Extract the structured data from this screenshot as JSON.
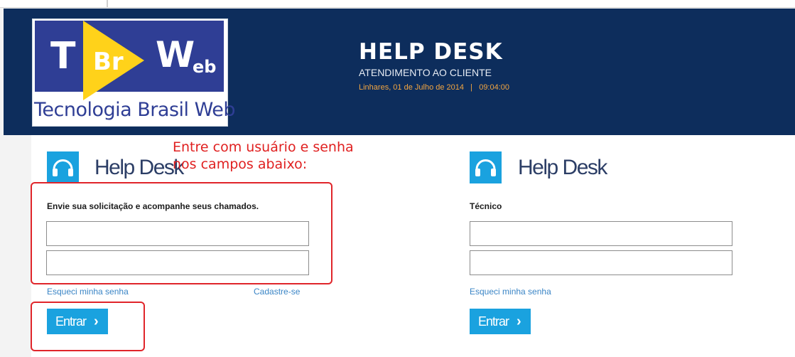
{
  "header": {
    "logo": {
      "letter_t": "T",
      "letters_br": "Br",
      "letter_w": "W",
      "letters_eb": "eb",
      "tagline": "Tecnologia Brasil Web"
    },
    "title": "HELP DESK",
    "subtitle": "ATENDIMENTO AO CLIENTE",
    "datetime": "Linhares, 01 de Julho de 2014   |   09:04:00"
  },
  "annotation": {
    "line1": "Entre com usuário e senha",
    "line2": "nos campos abaixo:"
  },
  "client_panel": {
    "title": "Help Desk",
    "description": "Envie sua solicitação e acompanhe seus chamados.",
    "username_value": "",
    "password_value": "",
    "forgot_link": "Esqueci minha senha",
    "register_link": "Cadastre-se",
    "submit_label": "Entrar",
    "submit_icon": "chevron-right-icon"
  },
  "tech_panel": {
    "title": "Help Desk",
    "description": "Técnico",
    "username_value": "",
    "password_value": "",
    "forgot_link": "Esqueci minha senha",
    "submit_label": "Entrar",
    "submit_icon": "chevron-right-icon"
  },
  "colors": {
    "header_bg": "#0d2d5c",
    "accent": "#1aa2df",
    "annotation": "#e02020",
    "link": "#3a85c6",
    "date": "#f2a541"
  }
}
